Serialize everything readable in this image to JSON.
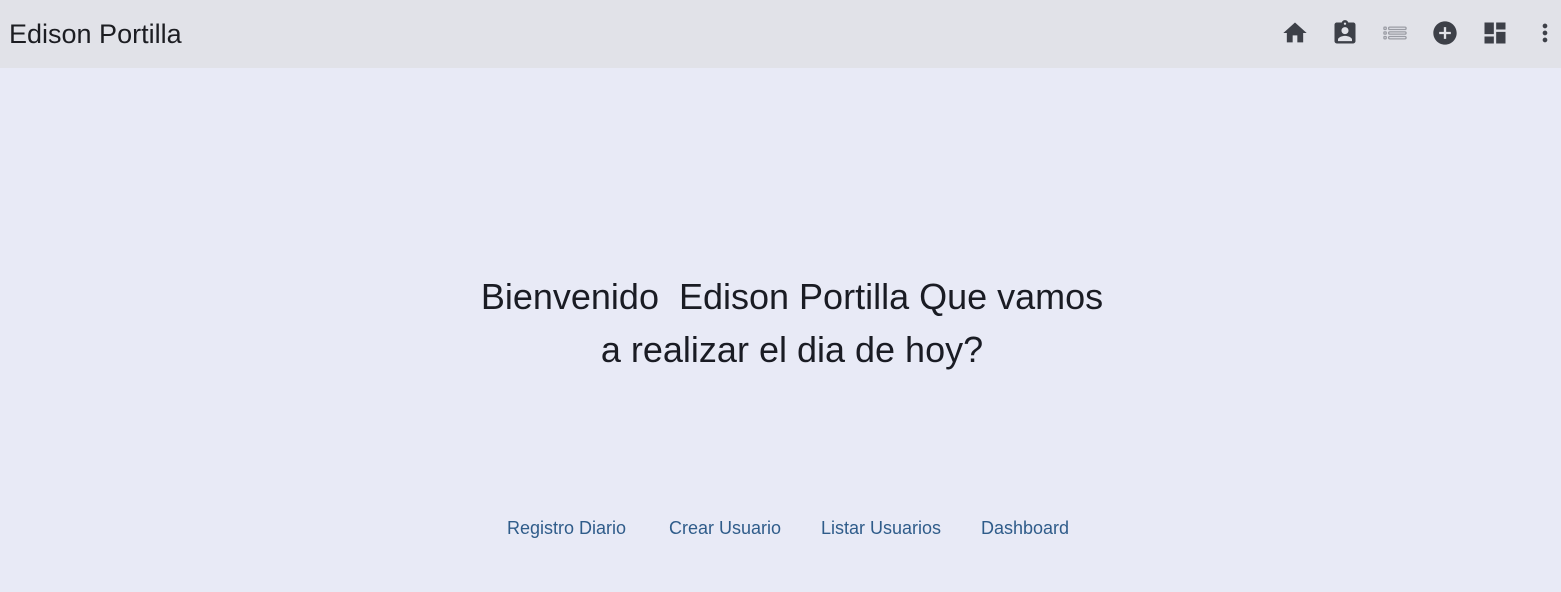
{
  "header": {
    "title": "Edison Portilla",
    "actions": [
      {
        "icon": "home-icon"
      },
      {
        "icon": "assignment-ind-icon"
      },
      {
        "icon": "list-icon"
      },
      {
        "icon": "add-circle-icon"
      },
      {
        "icon": "dashboard-icon"
      },
      {
        "icon": "more-vert-icon"
      }
    ]
  },
  "main": {
    "welcome_text": "Bienvenido  Edison Portilla Que vamos a realizar el dia de hoy?"
  },
  "nav": {
    "links": [
      {
        "label": "Registro Diario"
      },
      {
        "label": "Crear Usuario"
      },
      {
        "label": "Listar Usuarios"
      },
      {
        "label": "Dashboard"
      }
    ]
  },
  "colors": {
    "toolbar_bg": "#e1e2e8",
    "page_bg": "#e8eaf6",
    "link": "#2f5c8a",
    "icon": "#3d4048",
    "icon_disabled": "#9a9ca4"
  }
}
